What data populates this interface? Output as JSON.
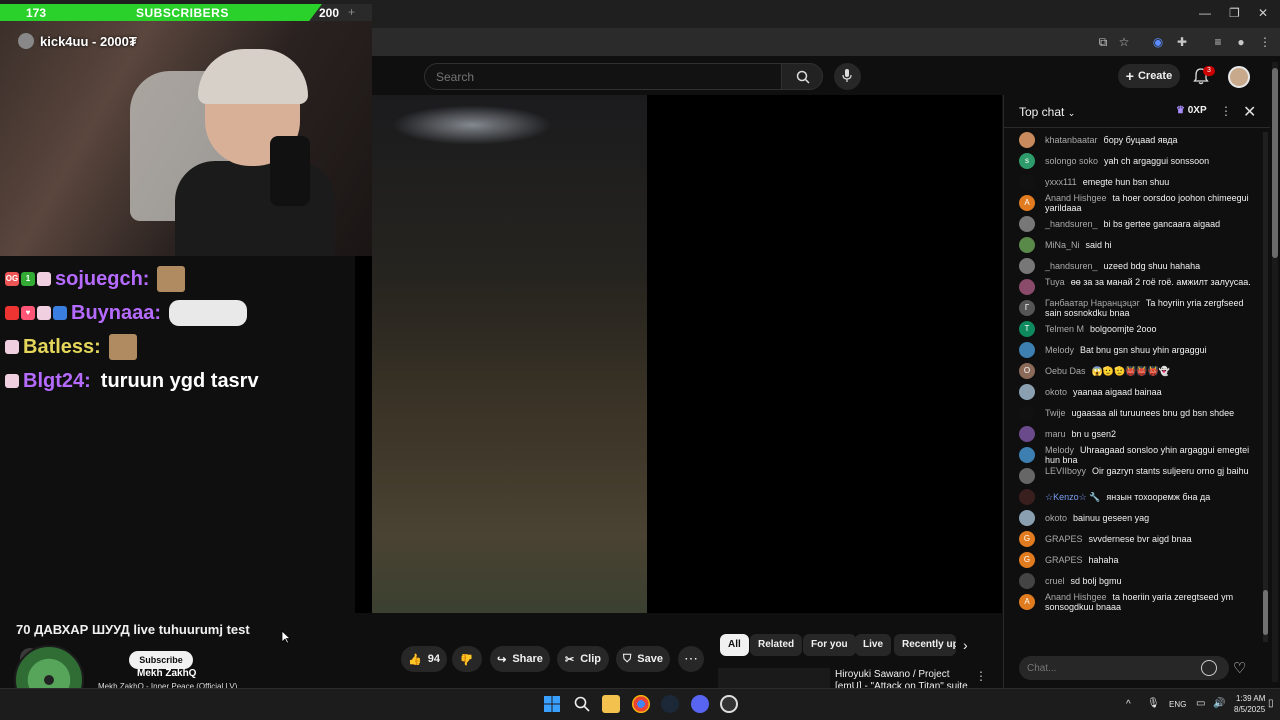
{
  "overlay": {
    "sub_count": "173",
    "sub_label": "SUBSCRIBERS",
    "sub_goal": "200",
    "sub_goal_fraction": 0.865,
    "sub_plus": "+",
    "donor": "kick4uu - 2000₮",
    "chat": [
      {
        "user": "sojuegch:",
        "color": "#b56bff",
        "badges": [
          "OG",
          "1",
          "cat"
        ]
      },
      {
        "user": "Buynaaa:",
        "color": "#b56bff",
        "badges": [
          "rocket",
          "heart",
          "cat",
          "grid"
        ]
      },
      {
        "user": "Batless:",
        "color": "#e3d65a",
        "badges": [
          "cat"
        ]
      },
      {
        "user": "Blgt24:",
        "color": "#b56bff",
        "badges": [
          "cat"
        ],
        "message": "turuun ygd tasrv"
      }
    ]
  },
  "masthead": {
    "search_placeholder": "Search",
    "create_label": "Create",
    "notification_count": "3"
  },
  "video": {
    "title": "70 ДАВХАР ШУУД live tuhuurumj test",
    "subscribe_label": "Subscribe",
    "likes": "94",
    "share_label": "Share",
    "clip_label": "Clip",
    "save_label": "Save"
  },
  "music": {
    "artist": "Mekh ZakhQ",
    "track": "Mekh ZakhQ - Inner Peace (Official LV)"
  },
  "chips": [
    "All",
    "Related",
    "For you",
    "Live",
    "Recently up"
  ],
  "recommendation": {
    "title": "Hiroyuki Sawano / Project [emU] - \"Attack on Titan\" suite"
  },
  "chat": {
    "header": "Top chat",
    "xp": "0XP",
    "input_placeholder": "Chat...",
    "messages": [
      {
        "author": "khatanbaatar",
        "text": "бору буцааd явда",
        "avatar_color": "#c98b5e",
        "initial": ""
      },
      {
        "author": "solongo soko",
        "text": "yah ch argaggui sonssoon",
        "avatar_color": "#2e9c6a",
        "initial": "s"
      },
      {
        "author": "yxxx111",
        "text": "emegte hun bsn shuu",
        "avatar_color": "#111111",
        "initial": ""
      },
      {
        "author": "Anand Hishgee",
        "text": "ta hoer oorsdoo joohon chimeegui yarildaaa",
        "avatar_color": "#e07b1f",
        "initial": "A"
      },
      {
        "author": "_handsuren_",
        "text": "bi bs gertee gancaara aigaad",
        "avatar_color": "#777777",
        "initial": ""
      },
      {
        "author": "MiNa_Ni",
        "text": "said hi",
        "avatar_color": "#5a8a4a",
        "initial": ""
      },
      {
        "author": "_handsuren_",
        "text": "uzeed bdg shuu hahaha",
        "avatar_color": "#777777",
        "initial": ""
      },
      {
        "author": "Tuya",
        "text": "өө за за манай 2 гоё гоё. амжилт залуусаа.",
        "avatar_color": "#8a4a6a",
        "initial": ""
      },
      {
        "author": "Ганбаатар Наранцэцэг",
        "text": "Ta hoyriin yria zergfseed sain sosnokdku bnaa",
        "avatar_color": "#555555",
        "initial": "Г"
      },
      {
        "author": "Telmen M",
        "text": "bolgoomjte 2ooo",
        "avatar_color": "#0f8a5f",
        "initial": "T"
      },
      {
        "author": "Melody",
        "text": "Bat bnu gsn shuu yhin argaggui",
        "avatar_color": "#3c7fb0",
        "initial": ""
      },
      {
        "author": "Oebu Das",
        "text": "😱🫡🫡👹👹👹👻",
        "avatar_color": "#8b6a5a",
        "initial": "O"
      },
      {
        "author": "okoto",
        "text": "yaanaa aigaad bainaa",
        "avatar_color": "#8aa0b0",
        "initial": ""
      },
      {
        "author": "Twije",
        "text": "ugaasaa ali turuunees bnu gd bsn shdee",
        "avatar_color": "#111111",
        "initial": ""
      },
      {
        "author": "maru",
        "text": "bn u gsen2",
        "avatar_color": "#6a4a8a",
        "initial": ""
      },
      {
        "author": "Melody",
        "text": "Uhraagaad sonsloo yhin argaggui emegtei hun bna",
        "avatar_color": "#3c7fb0",
        "initial": ""
      },
      {
        "author": "LEVIIboyy",
        "text": "Oir gazryn stants suljeeru orno gj baihu",
        "avatar_color": "#666666",
        "initial": ""
      },
      {
        "author": "☆Kenzo☆ 🔧",
        "text": "янзын тохооремж бна да",
        "avatar_color": "#3a1f1f",
        "initial": "",
        "author_color": "#7a9cf0"
      },
      {
        "author": "okoto",
        "text": "bainuu geseen yag",
        "avatar_color": "#8aa0b0",
        "initial": ""
      },
      {
        "author": "GRAPES",
        "text": "svvdernese bvr aigd bnaa",
        "avatar_color": "#e07b1f",
        "initial": "G"
      },
      {
        "author": "GRAPES",
        "text": "hahaha",
        "avatar_color": "#e07b1f",
        "initial": "G"
      },
      {
        "author": "cruel",
        "text": "sd bolj bgmu",
        "avatar_color": "#444444",
        "initial": ""
      },
      {
        "author": "Anand Hishgee",
        "text": "ta hoeriin yaria zeregtseed ym sonsogdkuu bnaaa",
        "avatar_color": "#e07b1f",
        "initial": "A"
      }
    ]
  },
  "tray": {
    "lang": "ENG",
    "time": "1:39 AM",
    "date": "8/5/2025"
  },
  "colors": {
    "accent_green": "#2bd12b",
    "yt_bg": "#0f0f0f",
    "notif_red": "#cc0000"
  }
}
